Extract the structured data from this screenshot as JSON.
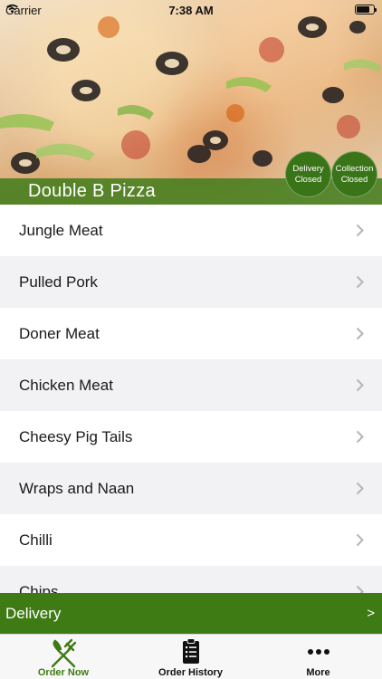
{
  "status_bar": {
    "carrier": "Carrier",
    "time": "7:38 AM"
  },
  "header": {
    "restaurant_name": "Double B Pizza",
    "badges": {
      "delivery": {
        "line1": "Delivery",
        "line2": "Closed"
      },
      "collection": {
        "line1": "Collection",
        "line2": "Closed"
      }
    }
  },
  "menu": {
    "items": [
      {
        "label": "Jungle Meat"
      },
      {
        "label": "Pulled Pork"
      },
      {
        "label": "Doner Meat"
      },
      {
        "label": "Chicken Meat"
      },
      {
        "label": "Cheesy Pig Tails"
      },
      {
        "label": "Wraps and Naan"
      },
      {
        "label": "Chilli"
      },
      {
        "label": "Chips"
      }
    ]
  },
  "delivery_bar": {
    "label": "Delivery",
    "arrow": ">"
  },
  "tabs": [
    {
      "label": "Order Now",
      "icon": "fork-knife-icon",
      "active": true
    },
    {
      "label": "Order History",
      "icon": "clipboard-list-icon",
      "active": false
    },
    {
      "label": "More",
      "icon": "more-dots-icon",
      "active": false
    }
  ],
  "colors": {
    "brand_green": "#3f7b14",
    "badge_green": "#3a7418",
    "alt_row": "#f2f2f4"
  }
}
